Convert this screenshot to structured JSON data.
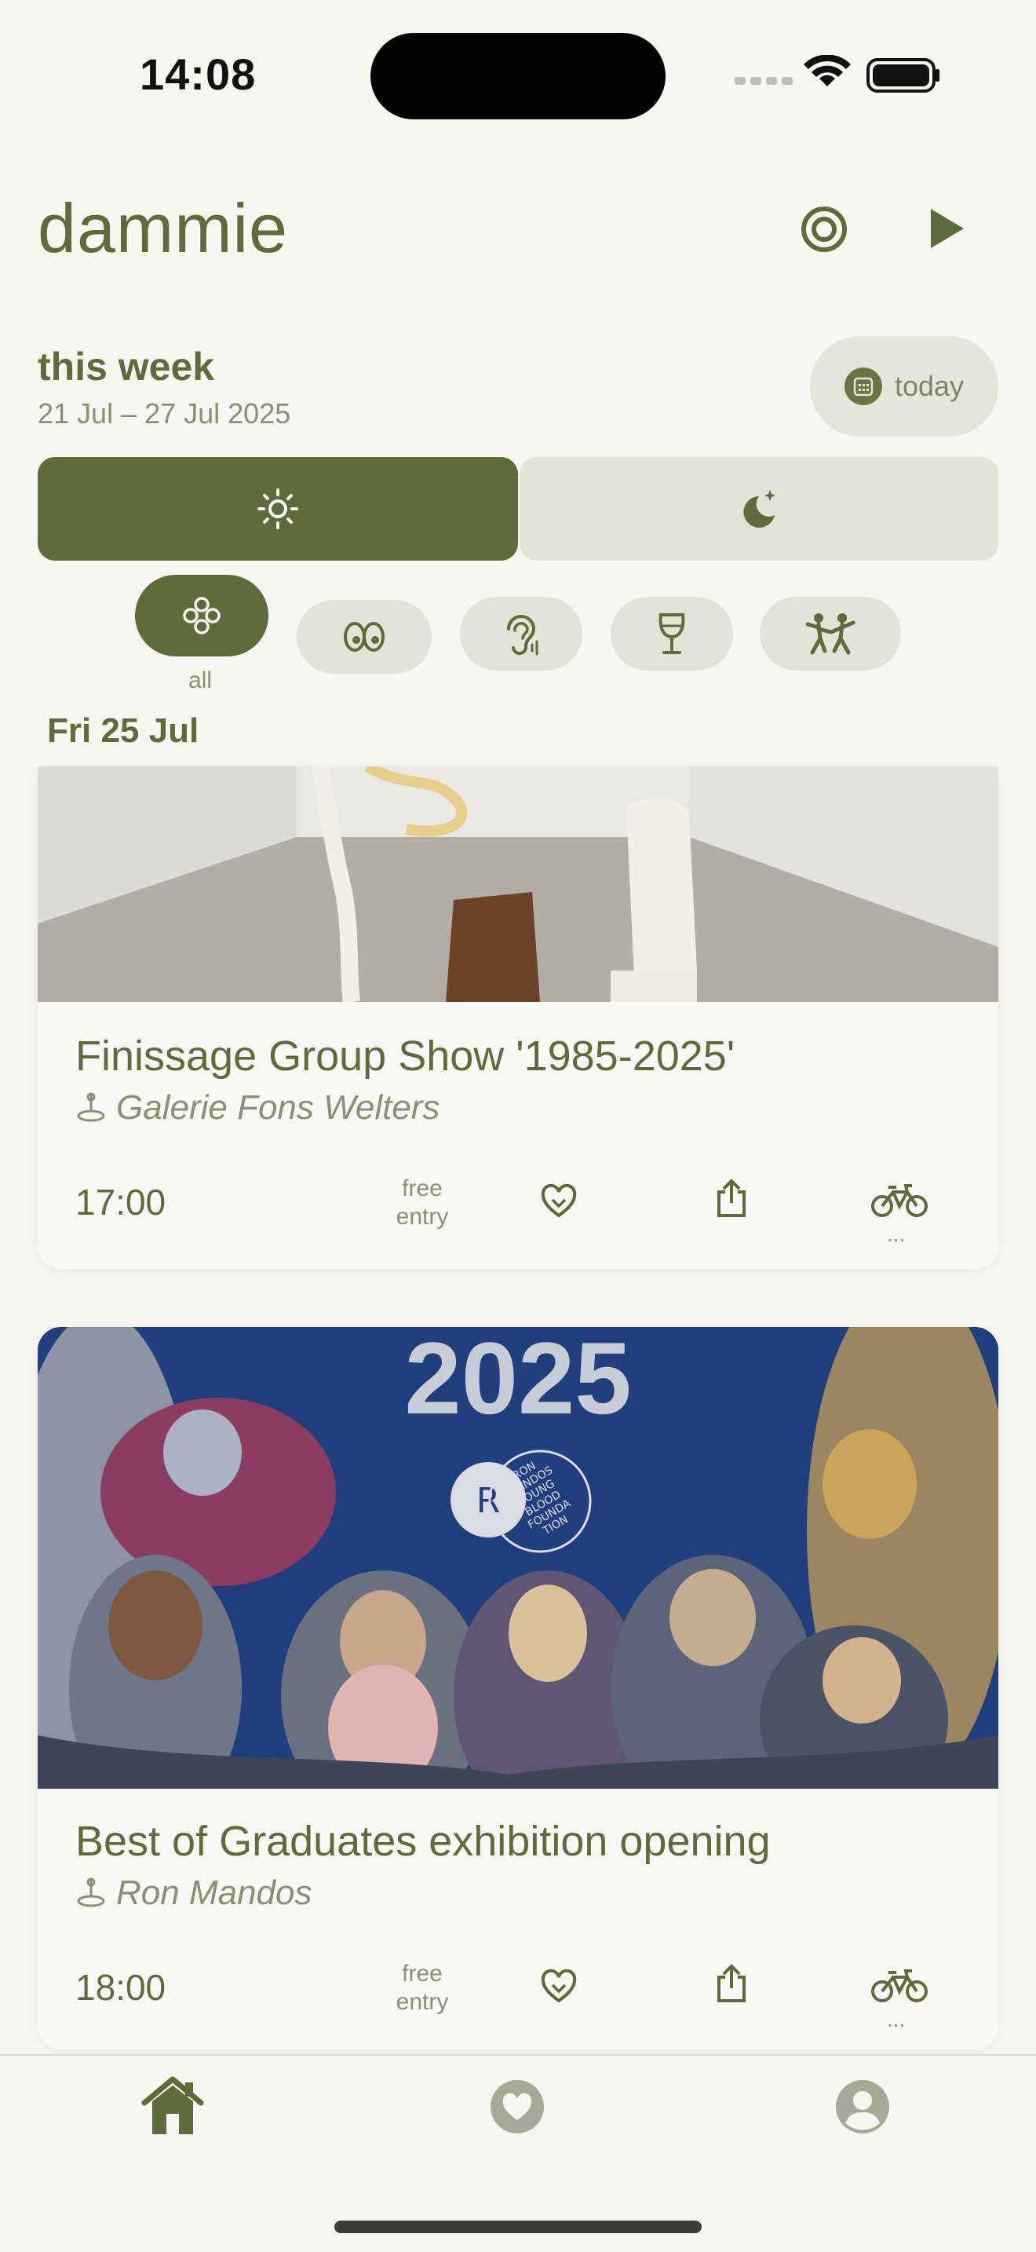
{
  "status_bar": {
    "time": "14:08"
  },
  "header": {
    "app_title": "dammie"
  },
  "week": {
    "title": "this week",
    "range": "21 Jul – 27 Jul 2025",
    "today_label": "today"
  },
  "filters": {
    "all_label": "all"
  },
  "date_header": "Fri 25 Jul",
  "events": [
    {
      "title": "Finissage Group Show '1985-2025'",
      "venue": "Galerie Fons Welters",
      "time": "17:00",
      "price_line1": "free",
      "price_line2": "entry",
      "more": "..."
    },
    {
      "title": "Best of Graduates exhibition opening",
      "venue": "Ron Mandos",
      "time": "18:00",
      "price_line1": "free",
      "price_line2": "entry",
      "more": "...",
      "poster_year": "2025",
      "poster_badge": [
        "RON",
        "MANDOS",
        "YOUNG",
        "BLOOD",
        "FOUNDA",
        "TION"
      ]
    }
  ],
  "colors": {
    "accent": "#5f6b3a",
    "chip_bg": "#e4e3d7",
    "background": "#f7f6f1"
  }
}
